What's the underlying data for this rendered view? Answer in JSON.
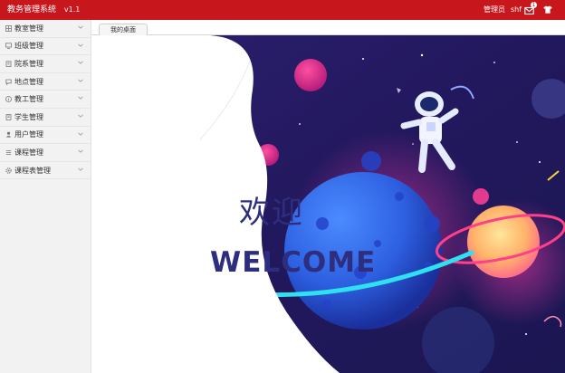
{
  "header": {
    "title": "教务管理系统",
    "version": "v1.1",
    "role": "管理员",
    "username": "shf",
    "notification_count": "1"
  },
  "sidebar": {
    "items": [
      {
        "label": "教室管理",
        "icon": "grid-icon"
      },
      {
        "label": "班级管理",
        "icon": "monitor-icon"
      },
      {
        "label": "院系管理",
        "icon": "building-icon"
      },
      {
        "label": "地点管理",
        "icon": "chat-icon"
      },
      {
        "label": "教工管理",
        "icon": "info-icon"
      },
      {
        "label": "学生管理",
        "icon": "book-icon"
      },
      {
        "label": "用户管理",
        "icon": "user-icon"
      },
      {
        "label": "课程管理",
        "icon": "list-icon"
      },
      {
        "label": "课程表管理",
        "icon": "gear-icon"
      }
    ]
  },
  "tabs": [
    {
      "label": "我的桌面"
    }
  ],
  "main": {
    "welcome_cn": "欢迎",
    "welcome_en": "WELCOME"
  },
  "colors": {
    "header": "#c8161d",
    "sidebar_bg": "#f2f2f2",
    "welcome_text": "#2d2e7f",
    "space_bg": "#222063"
  }
}
